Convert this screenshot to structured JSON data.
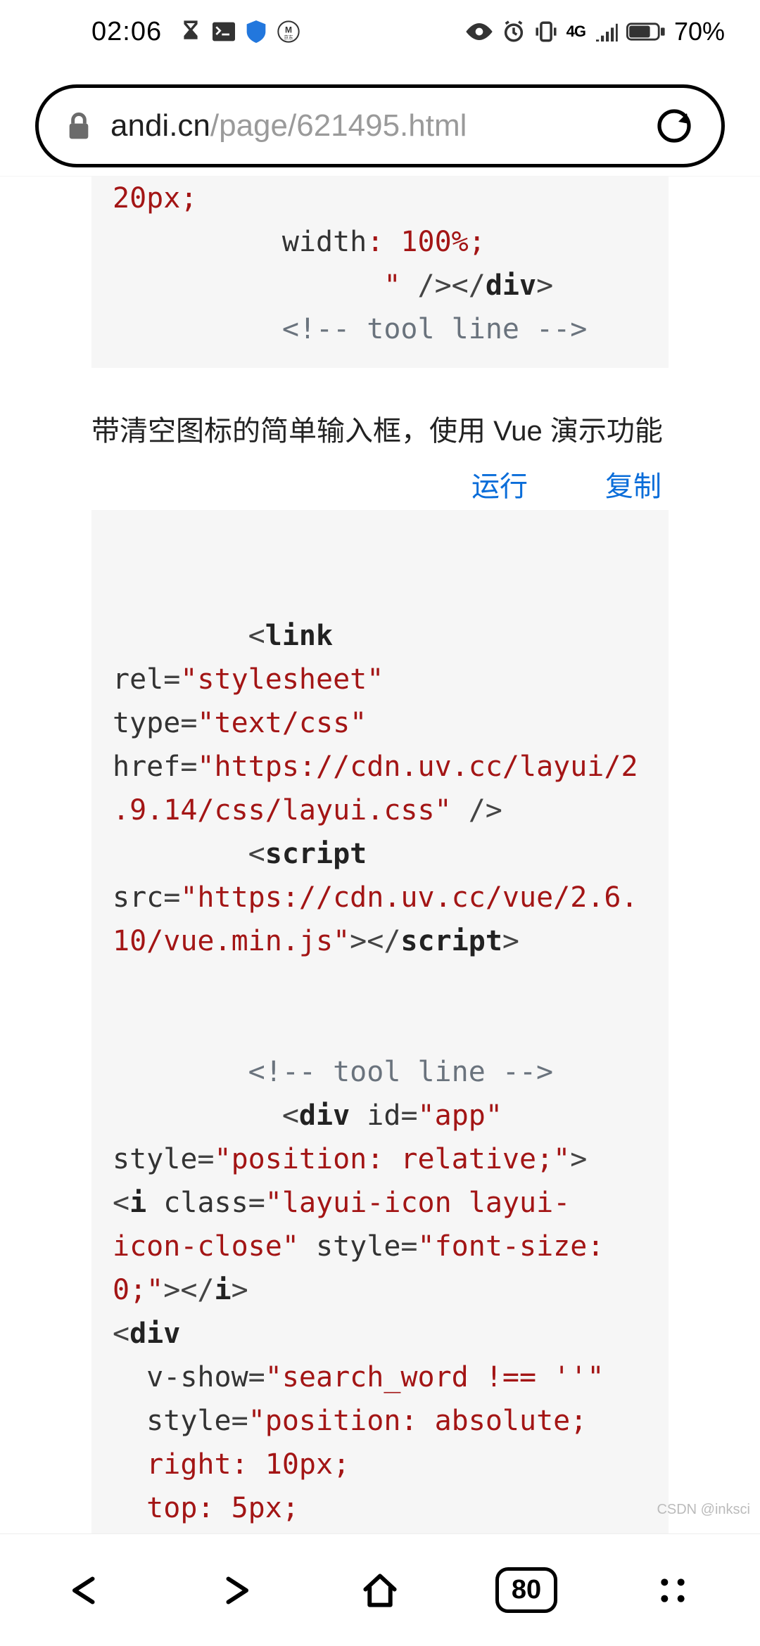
{
  "status": {
    "time": "02:06",
    "battery_pct": "70%",
    "network_label": "4G"
  },
  "address": {
    "host": "andi.cn",
    "path": "/page/621495.html"
  },
  "code1": {
    "l1": "20px;",
    "l2_attr": "width",
    "l2_sep": ": ",
    "l2_val": "100%",
    "l2_end": ";",
    "l3_quote": "\"",
    "l3_close": " /></",
    "l3_tag": "div",
    "l3_gt": ">",
    "l4_comment": "<!-- tool line -->"
  },
  "para": "带清空图标的简单输入框，使用 Vue 演示功能",
  "actions": {
    "run": "运行",
    "copy": "复制"
  },
  "code2": {
    "p1_open": "        <",
    "p1_tag": "link",
    "p2_attr": "rel",
    "p2_eq": "=",
    "p2_val": "\"stylesheet\"",
    "p3_attr": "type",
    "p3_eq": "=",
    "p3_val": "\"text/css\"",
    "p4_attr": "href",
    "p4_eq": "=",
    "p4_val": "\"https://cdn.uv.cc/layui/2.9.14/css/layui.css\"",
    "p4_end": " />",
    "p5_open": "        <",
    "p5_tag": "script",
    "p6_attr": "src",
    "p6_eq": "=",
    "p6_val": "\"https://cdn.uv.cc/vue/2.6.10/vue.min.js\"",
    "p6_mid": "></",
    "p6_tag": "script",
    "p6_gt": ">",
    "blank": "",
    "c1": "        <!-- tool line -->",
    "d1_open": "          <",
    "d1_tag": "div",
    "d1_sp": " ",
    "d1_attr": "id",
    "d1_eq": "=",
    "d1_val": "\"app\"",
    "d2_attr": "style",
    "d2_eq": "=",
    "d2_val": "\"position: relative;\"",
    "d2_gt": ">",
    "i1_open": "<",
    "i1_tag": "i",
    "i1_sp": " ",
    "i1_attr": "class",
    "i1_eq": "=",
    "i1_val": "\"layui-icon layui-icon-close\"",
    "i1_sp2": " ",
    "i1_attr2": "style",
    "i1_eq2": "=",
    "i1_val2": "\"font-size: 0;\"",
    "i1_mid": "></",
    "i1_tag2": "i",
    "i1_gt": ">",
    "dv_open": "<",
    "dv_tag": "div",
    "vs_attr": "v-show",
    "vs_eq": "=",
    "vs_val": "\"search_word !== ''\"",
    "st_attr": "style",
    "st_eq": "=",
    "st_val": "\"position: absolute;",
    "st_l2": "right: 10px;",
    "st_l3": "top: 5px;"
  },
  "watermark": "CSDN @inksci",
  "nav": {
    "tabs": "80"
  }
}
